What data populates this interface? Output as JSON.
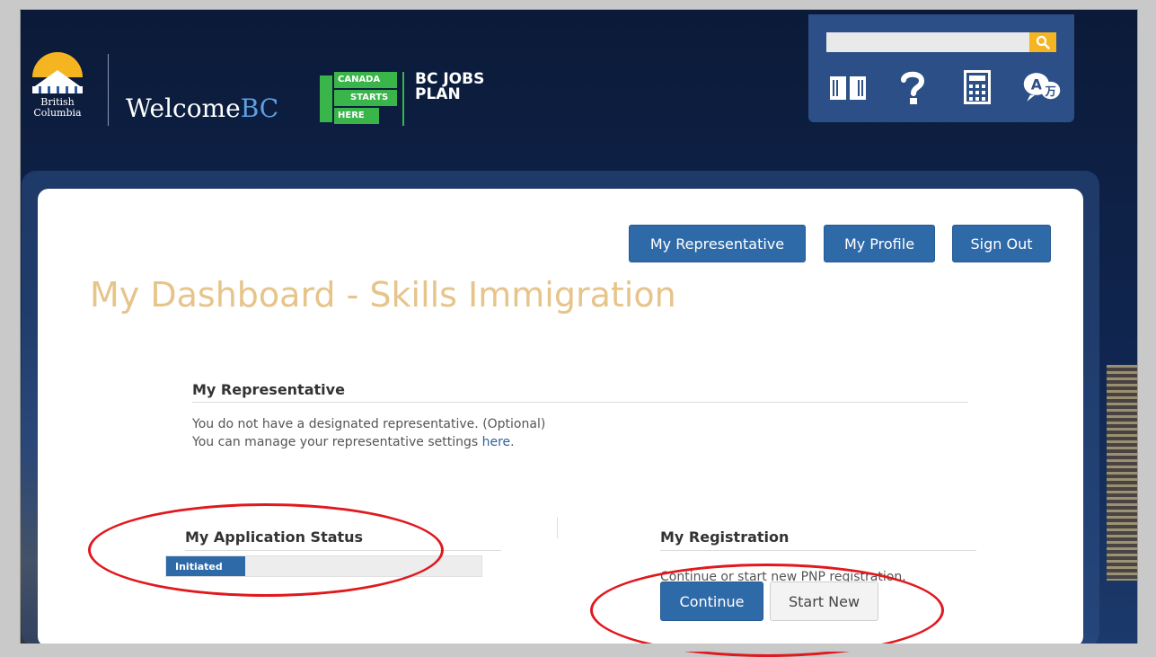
{
  "header": {
    "bc_logo_line1": "British",
    "bc_logo_line2": "Columbia",
    "welcome_prefix": "Welcome",
    "welcome_suffix": "BC",
    "canada_starts_here": [
      "CANADA",
      "STARTS",
      "HERE"
    ],
    "bc_jobs_plan": [
      "BC JOBS",
      "PLAN"
    ]
  },
  "utility": {
    "search_placeholder": "",
    "icons": [
      "book-icon",
      "help-icon",
      "calculator-icon",
      "translate-icon"
    ]
  },
  "nav": {
    "my_representative": "My Representative",
    "my_profile": "My Profile",
    "sign_out": "Sign Out"
  },
  "page": {
    "title": "My Dashboard - Skills Immigration"
  },
  "representative": {
    "heading": "My Representative",
    "line1": "You do not have a designated representative. (Optional)",
    "line2_prefix": "You can manage your representative settings ",
    "line2_link": "here",
    "line2_suffix": "."
  },
  "application_status": {
    "heading": "My Application Status",
    "status": "Initiated",
    "progress": 0.25
  },
  "registration": {
    "heading": "My Registration",
    "description": "Continue or start new PNP registration.",
    "continue_label": "Continue",
    "start_new_label": "Start New"
  },
  "colors": {
    "primary": "#2f6aa8",
    "title": "#e6c48a",
    "annotation": "#e0191e",
    "header_bg": "#0b1a38"
  }
}
